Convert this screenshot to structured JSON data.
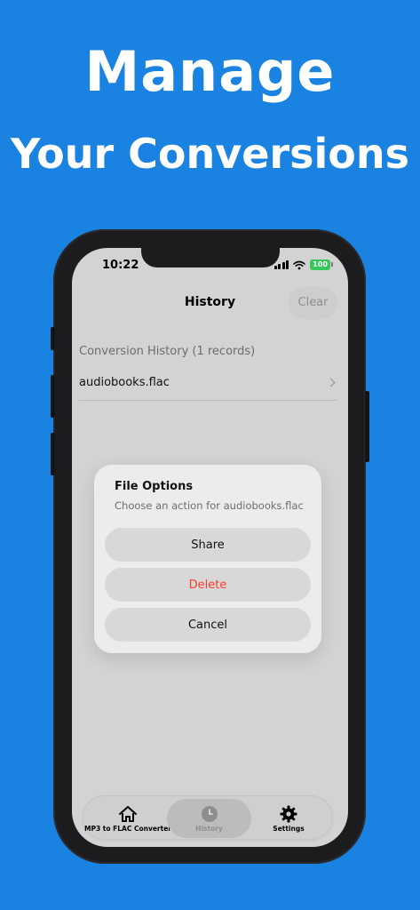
{
  "promo": {
    "line1": "Manage",
    "line2": "Your Conversions"
  },
  "status_bar": {
    "time": "10:22",
    "battery": "100"
  },
  "nav": {
    "title": "History",
    "clear_label": "Clear"
  },
  "history": {
    "section_header": "Conversion History (1 records)",
    "items": [
      {
        "filename": "audiobooks.flac"
      }
    ]
  },
  "dialog": {
    "title": "File Options",
    "message": "Choose an action for audiobooks.flac",
    "share_label": "Share",
    "delete_label": "Delete",
    "cancel_label": "Cancel"
  },
  "tabbar": {
    "tabs": [
      {
        "label": "MP3 to FLAC Converter",
        "icon": "house-icon"
      },
      {
        "label": "History",
        "icon": "clock-icon"
      },
      {
        "label": "Settings",
        "icon": "gear-icon"
      }
    ],
    "selected": "History"
  },
  "colors": {
    "background": "#1a82e0",
    "delete": "#ff3b30",
    "battery": "#35c759"
  }
}
